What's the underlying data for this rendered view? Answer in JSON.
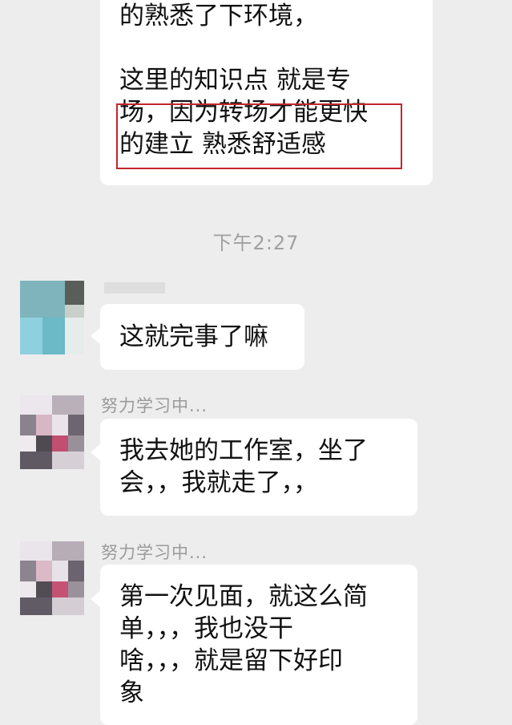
{
  "chat": {
    "first_bubble_lines": [
      "的熟悉了下环境，",
      "这里的知识点 就是专",
      "场，因为转场才能更快",
      "的建立 熟悉舒适感"
    ],
    "timestamp": "下午2:27",
    "messages": [
      {
        "sender": "",
        "lines": [
          "这就完事了嘛"
        ]
      },
      {
        "sender": "努力学习中...",
        "lines": [
          "我去她的工作室，坐了",
          "会，，我就走了，，"
        ]
      },
      {
        "sender": "努力学习中...",
        "lines": [
          "第一次见面，就这么简",
          "单，，，我也没干",
          "啥，，，就是留下好印",
          "象"
        ]
      }
    ]
  },
  "colors": {
    "background": "#ededed",
    "bubble": "#ffffff",
    "highlight_box": "#c2272d",
    "timestamp": "#a0a0a0",
    "sender_name": "#9a9a9a"
  }
}
